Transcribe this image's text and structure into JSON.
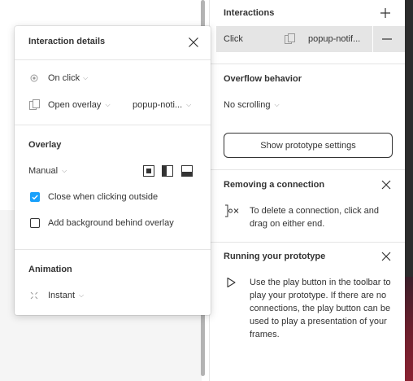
{
  "popover": {
    "title": "Interaction details",
    "trigger_value": "On click",
    "action_value": "Open overlay",
    "destination_value": "popup-noti...",
    "overlay_title": "Overlay",
    "position_value": "Manual",
    "close_outside_label": "Close when clicking outside",
    "close_outside_checked": true,
    "add_background_label": "Add background behind overlay",
    "add_background_checked": false,
    "animation_title": "Animation",
    "animation_value": "Instant"
  },
  "panel": {
    "interactions_title": "Interactions",
    "interaction_row": {
      "trigger": "Click",
      "destination": "popup-notif..."
    },
    "overflow_title": "Overflow behavior",
    "overflow_value": "No scrolling",
    "show_settings_label": "Show prototype settings",
    "tips": [
      {
        "title": "Removing a connection",
        "body": "To delete a connection, click and drag on either end.",
        "icon": "connection-icon"
      },
      {
        "title": "Running your prototype",
        "body": "Use the play button in the toolbar to play your prototype. If there are no connections, the play button can be used to play a presentation of your frames.",
        "icon": "play-icon"
      }
    ]
  },
  "colors": {
    "accent": "#18a0fb",
    "row_highlight": "#e5e5e5",
    "text": "#333333",
    "muted": "#999999"
  }
}
